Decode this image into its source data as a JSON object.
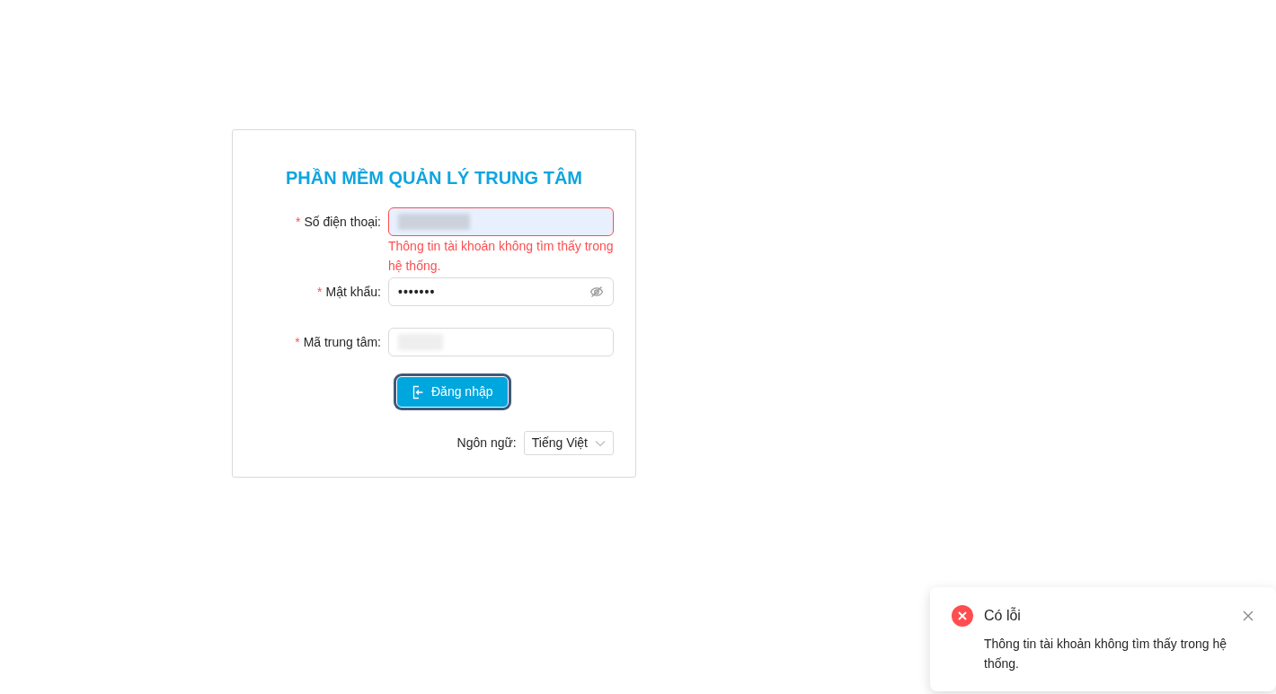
{
  "title": "PHẦN MỀM QUẢN LÝ TRUNG TÂM",
  "fields": [
    {
      "kind": "text",
      "required_mark": "*",
      "label": "Số điện thoại:",
      "autofilled": true,
      "error": "Thông tin tài khoản không tìm thấy trong hệ thống."
    },
    {
      "kind": "password",
      "required_mark": "*",
      "label": "Mật khẩu:",
      "value": "•••••••"
    },
    {
      "kind": "text",
      "required_mark": "*",
      "label": "Mã trung tâm:",
      "autofilled": false
    }
  ],
  "login_button": {
    "label": "Đăng nhập",
    "focused": true
  },
  "language": {
    "label": "Ngôn ngữ:",
    "value": "Tiếng Việt"
  },
  "notification": {
    "kind": "error",
    "title": "Có lỗi",
    "message": "Thông tin tài khoản không tìm thấy trong hệ thống."
  }
}
